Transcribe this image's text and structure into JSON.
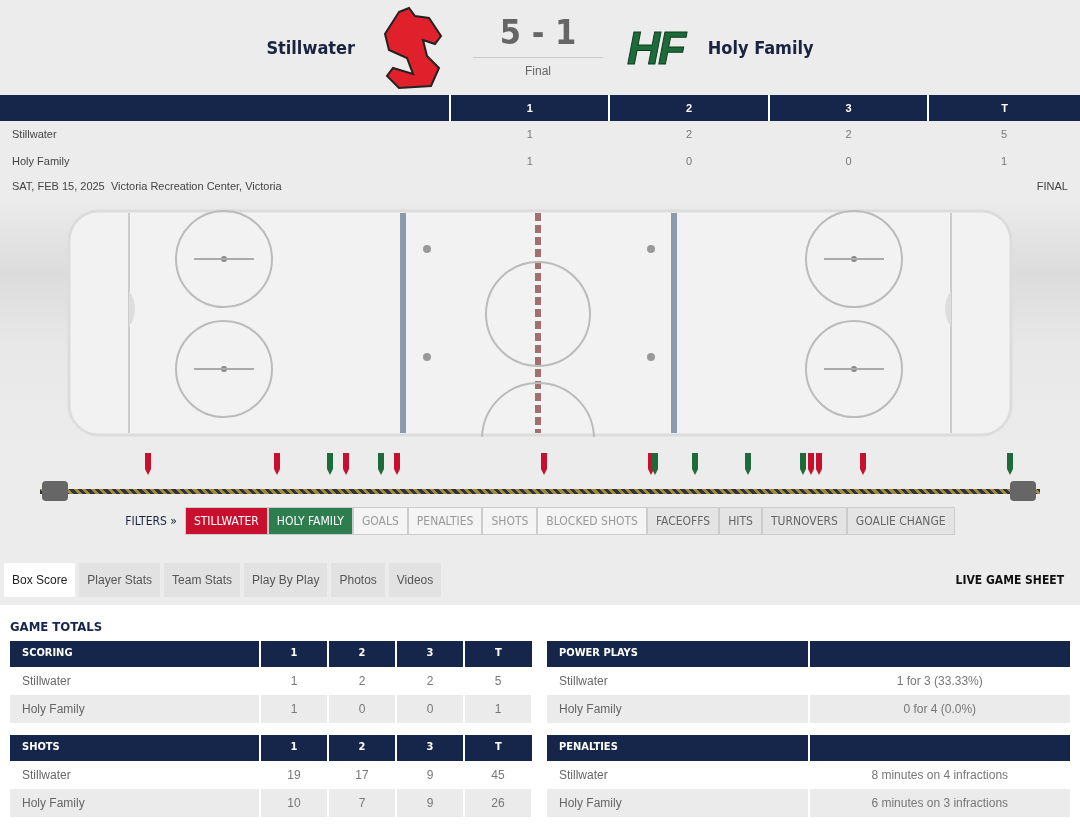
{
  "header": {
    "home": "Stillwater",
    "away": "Holy Family",
    "score": "5 - 1",
    "status": "Final",
    "away_logo": "HF"
  },
  "linescore": {
    "columns": [
      "1",
      "2",
      "3",
      "T"
    ],
    "rows": [
      {
        "team": "Stillwater",
        "values": [
          "1",
          "2",
          "2",
          "5"
        ]
      },
      {
        "team": "Holy Family",
        "values": [
          "1",
          "0",
          "0",
          "1"
        ]
      }
    ],
    "date": "SAT, FEB 15, 2025",
    "venue": "Victoria Recreation Center, Victoria",
    "status": "FINAL"
  },
  "timeline": {
    "markers": [
      {
        "color": "#c8102e"
      },
      {
        "color": "#c8102e"
      },
      {
        "color": "#1e6b3a"
      },
      {
        "color": "#c8102e"
      },
      {
        "color": "#1e6b3a"
      },
      {
        "color": "#c8102e"
      },
      {
        "color": "#c8102e"
      },
      {
        "color": "#c8102e"
      },
      {
        "color": "#1e6b3a"
      },
      {
        "color": "#1e6b3a"
      },
      {
        "color": "#1e6b3a"
      },
      {
        "color": "#1e6b3a"
      },
      {
        "color": "#c8102e"
      },
      {
        "color": "#c8102e"
      },
      {
        "color": "#c8102e"
      },
      {
        "color": "#1e6b3a"
      }
    ]
  },
  "filters": {
    "label": "FILTERS »",
    "items": [
      {
        "label": "STILLWATER",
        "kind": "team",
        "color": "#c8102e",
        "disabled": false
      },
      {
        "label": "HOLY FAMILY",
        "kind": "team",
        "color": "#2e7d4f",
        "disabled": false
      },
      {
        "label": "GOALS",
        "kind": "event",
        "disabled": true
      },
      {
        "label": "PENALTIES",
        "kind": "event",
        "disabled": true
      },
      {
        "label": "SHOTS",
        "kind": "event",
        "disabled": true
      },
      {
        "label": "BLOCKED SHOTS",
        "kind": "event",
        "disabled": true
      },
      {
        "label": "FACEOFFS",
        "kind": "event",
        "disabled": false
      },
      {
        "label": "HITS",
        "kind": "event",
        "disabled": false
      },
      {
        "label": "TURNOVERS",
        "kind": "event",
        "disabled": false
      },
      {
        "label": "GOALIE CHANGE",
        "kind": "event",
        "disabled": false
      }
    ]
  },
  "tabs": [
    {
      "label": "Box Score",
      "selected": true
    },
    {
      "label": "Player Stats",
      "selected": false
    },
    {
      "label": "Team Stats",
      "selected": false
    },
    {
      "label": "Play By Play",
      "selected": false
    },
    {
      "label": "Photos",
      "selected": false
    },
    {
      "label": "Videos",
      "selected": false
    }
  ],
  "live_sheet": "LIVE GAME SHEET",
  "section_title": "GAME TOTALS",
  "scoring": {
    "title": "SCORING",
    "columns": [
      "1",
      "2",
      "3",
      "T"
    ],
    "rows": [
      {
        "team": "Stillwater",
        "values": [
          "1",
          "2",
          "2",
          "5"
        ]
      },
      {
        "team": "Holy Family",
        "values": [
          "1",
          "0",
          "0",
          "1"
        ]
      }
    ]
  },
  "power_plays": {
    "title": "POWER PLAYS",
    "rows": [
      {
        "team": "Stillwater",
        "value": "1 for 3 (33.33%)"
      },
      {
        "team": "Holy Family",
        "value": "0 for 4 (0.0%)"
      }
    ]
  },
  "shots": {
    "title": "SHOTS",
    "columns": [
      "1",
      "2",
      "3",
      "T"
    ],
    "rows": [
      {
        "team": "Stillwater",
        "values": [
          "19",
          "17",
          "9",
          "45"
        ]
      },
      {
        "team": "Holy Family",
        "values": [
          "10",
          "7",
          "9",
          "26"
        ]
      }
    ]
  },
  "penalties": {
    "title": "PENALTIES",
    "rows": [
      {
        "team": "Stillwater",
        "value": "8 minutes on 4 infractions"
      },
      {
        "team": "Holy Family",
        "value": "6 minutes on 3 infractions"
      }
    ]
  }
}
